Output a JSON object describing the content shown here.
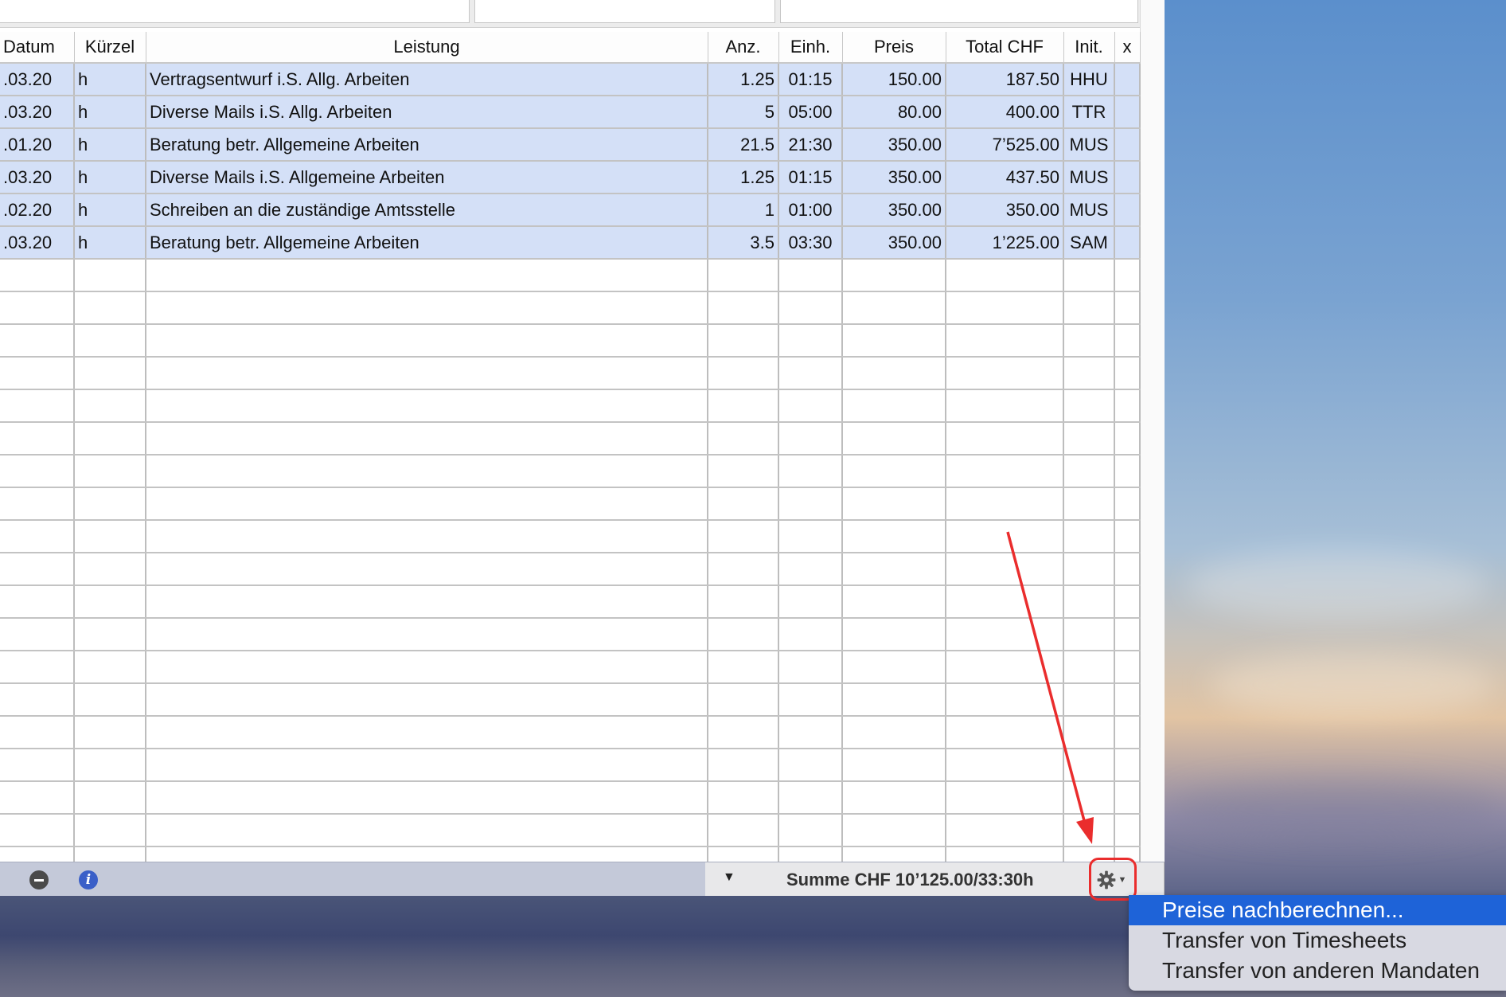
{
  "table": {
    "headers": [
      "Datum",
      "Kürzel",
      "Leistung",
      "Anz.",
      "Einh.",
      "Preis",
      "Total CHF",
      "Init.",
      "x"
    ],
    "rows": [
      {
        "datum": ".03.20",
        "kuerzel": "h",
        "leistung": "Vertragsentwurf i.S. Allg. Arbeiten",
        "anz": "1.25",
        "einh": "01:15",
        "preis": "150.00",
        "total": "187.50",
        "init": "HHU"
      },
      {
        "datum": ".03.20",
        "kuerzel": "h",
        "leistung": "Diverse Mails i.S. Allg. Arbeiten",
        "anz": "5",
        "einh": "05:00",
        "preis": "80.00",
        "total": "400.00",
        "init": "TTR"
      },
      {
        "datum": ".01.20",
        "kuerzel": "h",
        "leistung": "Beratung betr. Allgemeine Arbeiten",
        "anz": "21.5",
        "einh": "21:30",
        "preis": "350.00",
        "total": "7’525.00",
        "init": "MUS"
      },
      {
        "datum": ".03.20",
        "kuerzel": "h",
        "leistung": "Diverse Mails i.S. Allgemeine Arbeiten",
        "anz": "1.25",
        "einh": "01:15",
        "preis": "350.00",
        "total": "437.50",
        "init": "MUS"
      },
      {
        "datum": ".02.20",
        "kuerzel": "h",
        "leistung": "Schreiben an die zuständige Amtsstelle",
        "anz": "1",
        "einh": "01:00",
        "preis": "350.00",
        "total": "350.00",
        "init": "MUS"
      },
      {
        "datum": ".03.20",
        "kuerzel": "h",
        "leistung": "Beratung betr. Allgemeine Arbeiten",
        "anz": "3.5",
        "einh": "03:30",
        "preis": "350.00",
        "total": "1’225.00",
        "init": "SAM"
      }
    ],
    "empty_rows": 19
  },
  "bottombar": {
    "minus_icon": "minus-circle-icon",
    "info_icon": "info-icon",
    "summe_text": "Summe CHF 10’125.00/33:30h",
    "gear_icon": "gear-icon"
  },
  "menu": {
    "items": [
      "Preise nachberechnen...",
      "Transfer von Timesheets",
      "Transfer von anderen Mandaten"
    ],
    "selected_index": 0
  },
  "colors": {
    "row_highlight": "#d4e0f7",
    "menu_selected": "#1e63d8",
    "annotation_red": "#ea2d2d"
  }
}
